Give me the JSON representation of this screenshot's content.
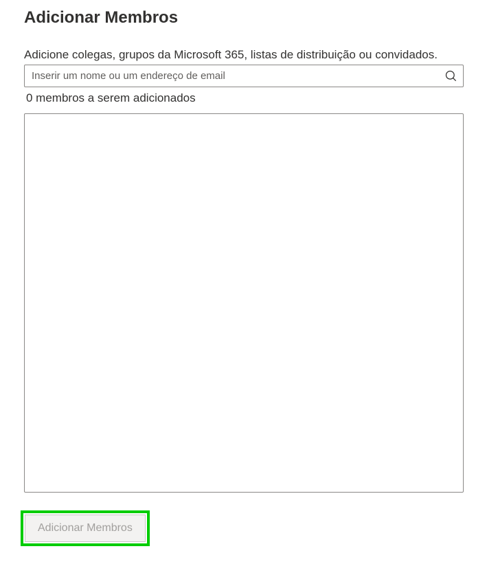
{
  "dialog": {
    "title": "Adicionar Membros",
    "instruction": "Adicione colegas, grupos da Microsoft 365, listas de distribuição ou convidados.",
    "search_placeholder": "Inserir um nome ou um endereço de email",
    "members_count_text": "0 membros a serem adicionados",
    "add_button_label": "Adicionar Membros"
  }
}
